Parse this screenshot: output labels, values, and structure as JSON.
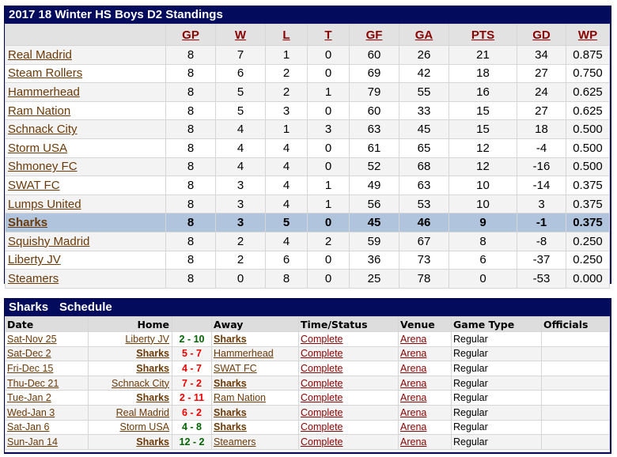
{
  "standings": {
    "title": "2017 18 Winter HS Boys D2 Standings",
    "columns": [
      "GP",
      "W",
      "L",
      "T",
      "GF",
      "GA",
      "PTS",
      "GD",
      "WP"
    ],
    "rows": [
      {
        "team": "Real Madrid",
        "gp": "8",
        "w": "7",
        "l": "1",
        "t": "0",
        "gf": "60",
        "ga": "26",
        "pts": "21",
        "gd": "34",
        "wp": "0.875"
      },
      {
        "team": "Steam Rollers",
        "gp": "8",
        "w": "6",
        "l": "2",
        "t": "0",
        "gf": "69",
        "ga": "42",
        "pts": "18",
        "gd": "27",
        "wp": "0.750"
      },
      {
        "team": "Hammerhead",
        "gp": "8",
        "w": "5",
        "l": "2",
        "t": "1",
        "gf": "79",
        "ga": "55",
        "pts": "16",
        "gd": "24",
        "wp": "0.625"
      },
      {
        "team": "Ram Nation",
        "gp": "8",
        "w": "5",
        "l": "3",
        "t": "0",
        "gf": "60",
        "ga": "33",
        "pts": "15",
        "gd": "27",
        "wp": "0.625"
      },
      {
        "team": "Schnack City",
        "gp": "8",
        "w": "4",
        "l": "1",
        "t": "3",
        "gf": "63",
        "ga": "45",
        "pts": "15",
        "gd": "18",
        "wp": "0.500"
      },
      {
        "team": "Storm USA",
        "gp": "8",
        "w": "4",
        "l": "4",
        "t": "0",
        "gf": "61",
        "ga": "65",
        "pts": "12",
        "gd": "-4",
        "wp": "0.500"
      },
      {
        "team": "Shmoney FC",
        "gp": "8",
        "w": "4",
        "l": "4",
        "t": "0",
        "gf": "52",
        "ga": "68",
        "pts": "12",
        "gd": "-16",
        "wp": "0.500"
      },
      {
        "team": "SWAT FC",
        "gp": "8",
        "w": "3",
        "l": "4",
        "t": "1",
        "gf": "49",
        "ga": "63",
        "pts": "10",
        "gd": "-14",
        "wp": "0.375"
      },
      {
        "team": "Lumps United",
        "gp": "8",
        "w": "3",
        "l": "4",
        "t": "1",
        "gf": "56",
        "ga": "53",
        "pts": "10",
        "gd": "3",
        "wp": "0.375"
      },
      {
        "team": "Sharks",
        "gp": "8",
        "w": "3",
        "l": "5",
        "t": "0",
        "gf": "45",
        "ga": "46",
        "pts": "9",
        "gd": "-1",
        "wp": "0.375",
        "highlight": true
      },
      {
        "team": "Squishy Madrid",
        "gp": "8",
        "w": "2",
        "l": "4",
        "t": "2",
        "gf": "59",
        "ga": "67",
        "pts": "8",
        "gd": "-8",
        "wp": "0.250"
      },
      {
        "team": "Liberty JV",
        "gp": "8",
        "w": "2",
        "l": "6",
        "t": "0",
        "gf": "36",
        "ga": "73",
        "pts": "6",
        "gd": "-37",
        "wp": "0.250"
      },
      {
        "team": "Steamers",
        "gp": "8",
        "w": "0",
        "l": "8",
        "t": "0",
        "gf": "25",
        "ga": "78",
        "pts": "0",
        "gd": "-53",
        "wp": "0.000"
      }
    ]
  },
  "schedule": {
    "team": "Sharks",
    "title": "Schedule",
    "columns": {
      "date": "Date",
      "home": "Home",
      "away": "Away",
      "status": "Time/Status",
      "venue": "Venue",
      "game_type": "Game Type",
      "officials": "Officials"
    },
    "rows": [
      {
        "date": "Sat-Nov 25",
        "home": "Liberty JV",
        "score": "2 - 10",
        "result": "win",
        "away": "Sharks",
        "status": "Complete",
        "venue": "Arena",
        "game_type": "Regular",
        "officials": ""
      },
      {
        "date": "Sat-Dec 2",
        "home": "Sharks",
        "score": "5 - 7",
        "result": "loss",
        "away": "Hammerhead",
        "status": "Complete",
        "venue": "Arena",
        "game_type": "Regular",
        "officials": ""
      },
      {
        "date": "Fri-Dec 15",
        "home": "Sharks",
        "score": "4 - 7",
        "result": "loss",
        "away": "SWAT FC",
        "status": "Complete",
        "venue": "Arena",
        "game_type": "Regular",
        "officials": ""
      },
      {
        "date": "Thu-Dec 21",
        "home": "Schnack City",
        "score": "7 - 2",
        "result": "loss",
        "away": "Sharks",
        "status": "Complete",
        "venue": "Arena",
        "game_type": "Regular",
        "officials": ""
      },
      {
        "date": "Tue-Jan 2",
        "home": "Sharks",
        "score": "2 - 11",
        "result": "loss",
        "away": "Ram Nation",
        "status": "Complete",
        "venue": "Arena",
        "game_type": "Regular",
        "officials": ""
      },
      {
        "date": "Wed-Jan 3",
        "home": "Real Madrid",
        "score": "6 - 2",
        "result": "loss",
        "away": "Sharks",
        "status": "Complete",
        "venue": "Arena",
        "game_type": "Regular",
        "officials": ""
      },
      {
        "date": "Sat-Jan 6",
        "home": "Storm USA",
        "score": "4 - 8",
        "result": "win",
        "away": "Sharks",
        "status": "Complete",
        "venue": "Arena",
        "game_type": "Regular",
        "officials": ""
      },
      {
        "date": "Sun-Jan 14",
        "home": "Sharks",
        "score": "12 - 2",
        "result": "win",
        "away": "Steamers",
        "status": "Complete",
        "venue": "Arena",
        "game_type": "Regular",
        "officials": ""
      }
    ]
  }
}
